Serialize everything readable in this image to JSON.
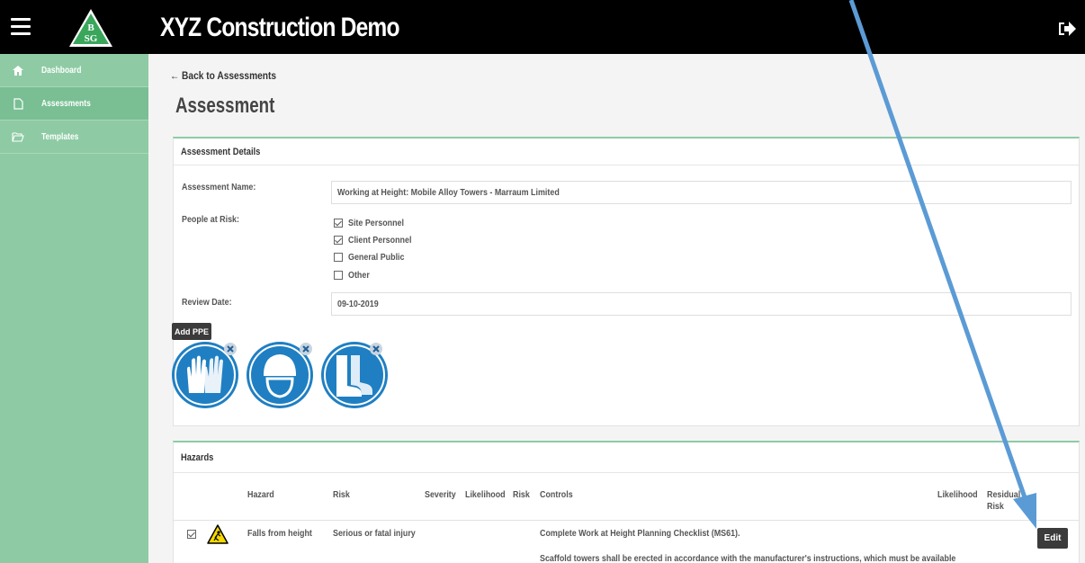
{
  "header": {
    "title": "XYZ Construction Demo",
    "logo_text_top": "B",
    "logo_text_bottom": "SG"
  },
  "sidebar": {
    "items": [
      {
        "label": "Dashboard",
        "icon": "home-icon",
        "active": false
      },
      {
        "label": "Assessments",
        "icon": "file-icon",
        "active": true
      },
      {
        "label": "Templates",
        "icon": "folder-open-icon",
        "active": false
      }
    ]
  },
  "main": {
    "back_link": "← Back to Assessments",
    "page_title": "Assessment"
  },
  "details": {
    "heading": "Assessment Details",
    "name_label": "Assessment Name:",
    "name_value": "Working at Height: Mobile Alloy Towers - Marraum Limited",
    "people_label": "People at Risk:",
    "people": [
      {
        "label": "Site Personnel",
        "checked": true
      },
      {
        "label": "Client Personnel",
        "checked": true
      },
      {
        "label": "General Public",
        "checked": false
      },
      {
        "label": "Other",
        "checked": false
      }
    ],
    "review_label": "Review Date:",
    "review_value": "09-10-2019",
    "add_ppe_label": "Add PPE",
    "ppe": [
      "gloves-icon",
      "hard-hat-icon",
      "safety-boots-icon"
    ]
  },
  "hazards": {
    "heading": "Hazards",
    "columns": {
      "hazard": "Hazard",
      "risk": "Risk",
      "severity": "Severity",
      "likelihood": "Likelihood",
      "risk2": "Risk",
      "controls": "Controls",
      "likelihood2": "Likelihood",
      "residual": "Residual",
      "residual2": "Risk"
    },
    "rows": [
      {
        "checked": true,
        "hazard": "Falls from height",
        "risk": "Serious or fatal injury",
        "control_1": "Complete Work at Height Planning Checklist (MS61).",
        "control_2": "Scaffold towers shall be erected in accordance with the manufacturer's instructions, which must be available",
        "edit_label": "Edit"
      }
    ]
  },
  "colors": {
    "sidebar": "#8ecba4",
    "topbar": "#000000",
    "ppe_blue": "#1f7fc2",
    "arrow": "#5b9bd5"
  }
}
